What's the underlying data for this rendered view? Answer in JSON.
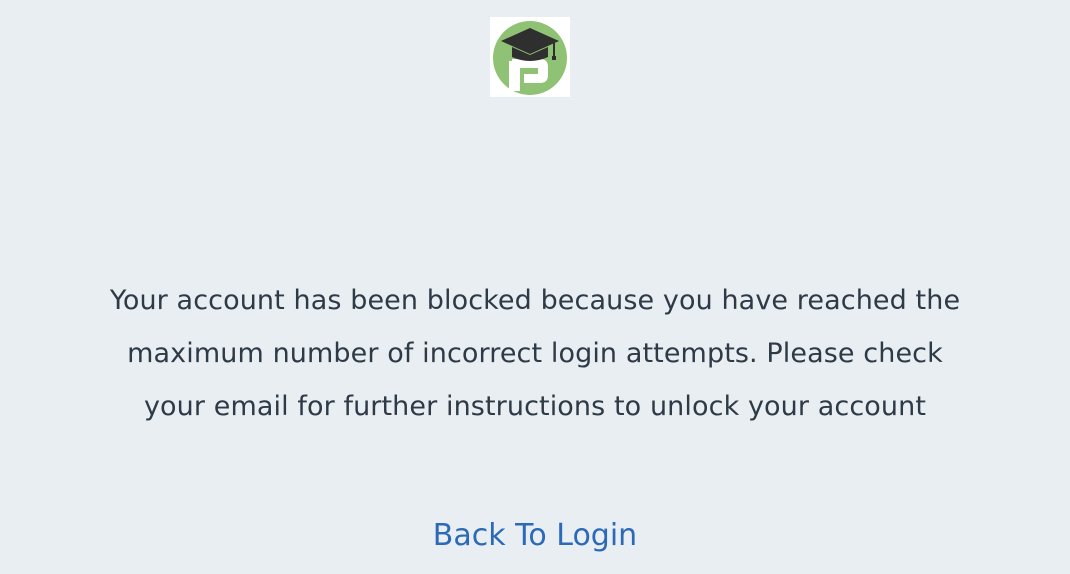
{
  "logo": {
    "icon": "graduation-cap-logo",
    "lettering": "P",
    "brand_color": "#8fc274",
    "cap_color": "#2f2f2f"
  },
  "message": {
    "lines": [
      "Your account has been blocked because you have reached the",
      "maximum number of incorrect login attempts. Please check",
      "your email for further instructions to unlock your account"
    ]
  },
  "actions": {
    "back_to_login": "Back To Login"
  },
  "colors": {
    "background": "#e9eef3",
    "text": "#2e3a45",
    "link": "#2c6ab8"
  }
}
